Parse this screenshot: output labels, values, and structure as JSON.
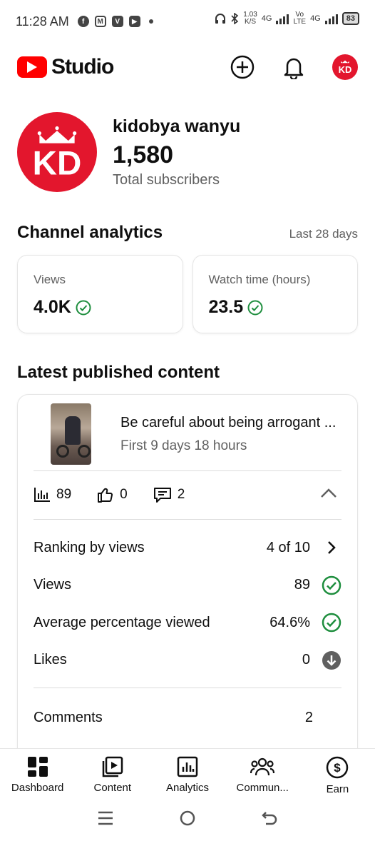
{
  "status_bar": {
    "time": "11:28 AM",
    "net_speed_value": "1.03",
    "net_speed_unit": "K/S",
    "net_type_1": "4G",
    "vo_lte_top": "Vo",
    "vo_lte_bottom": "LTE",
    "net_type_2": "4G",
    "battery": "83"
  },
  "header": {
    "app_name": "Studio",
    "avatar_initials": "KD"
  },
  "channel": {
    "name": "kidobya wanyu",
    "subscriber_count": "1,580",
    "subscriber_label": "Total subscribers",
    "avatar_initials": "KD"
  },
  "analytics": {
    "title": "Channel analytics",
    "period": "Last 28 days",
    "cards": [
      {
        "label": "Views",
        "value": "4.0K"
      },
      {
        "label": "Watch time (hours)",
        "value": "23.5"
      }
    ]
  },
  "latest": {
    "title": "Latest published content",
    "video_title": "Be careful about being arrogant ...",
    "video_meta": "First 9 days 18 hours",
    "stats": {
      "views": "89",
      "likes": "0",
      "comments": "2"
    },
    "details": [
      {
        "label": "Ranking by views",
        "value": "4 of 10",
        "icon": "chevron-right-icon"
      },
      {
        "label": "Views",
        "value": "89",
        "icon": "check-circle-icon"
      },
      {
        "label": "Average percentage viewed",
        "value": "64.6%",
        "icon": "check-circle-icon"
      },
      {
        "label": "Likes",
        "value": "0",
        "icon": "arrow-down-circle-icon"
      }
    ],
    "comments_label": "Comments",
    "comments_value": "2"
  },
  "bottom_nav": [
    {
      "label": "Dashboard",
      "icon": "dashboard-icon"
    },
    {
      "label": "Content",
      "icon": "content-icon"
    },
    {
      "label": "Analytics",
      "icon": "analytics-icon"
    },
    {
      "label": "Commun...",
      "icon": "community-icon"
    },
    {
      "label": "Earn",
      "icon": "earn-icon"
    }
  ],
  "colors": {
    "brand_red": "#ff0000",
    "avatar_red": "#e3162d",
    "success_green": "#1e8e3e"
  }
}
